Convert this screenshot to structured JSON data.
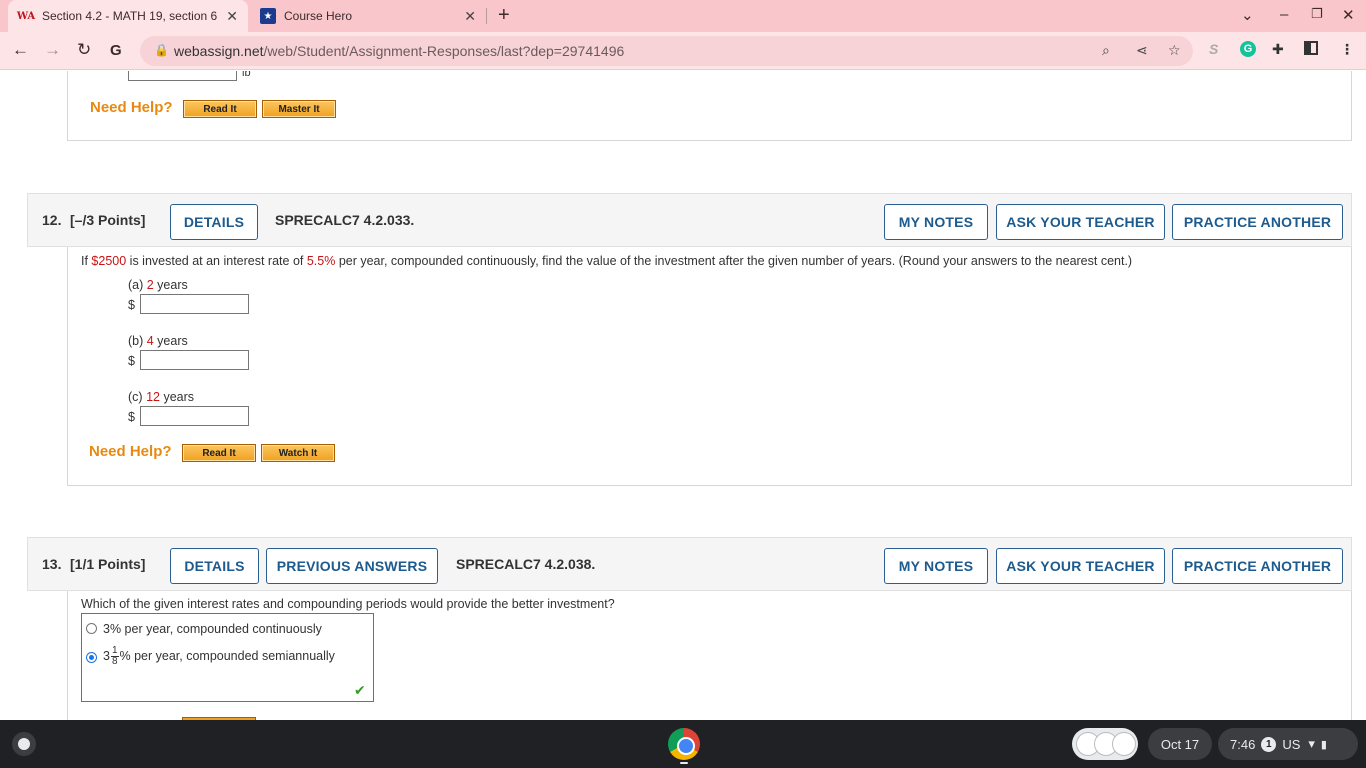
{
  "browser": {
    "tabs": [
      {
        "title": "Section 4.2 - MATH 19, section 6",
        "favicon": "webassign-icon"
      },
      {
        "title": "Course Hero",
        "favicon": "coursehero-icon"
      }
    ],
    "url_host": "webassign.net",
    "url_path": "/web/Student/Assignment-Responses/last?dep=29741496"
  },
  "prev_question": {
    "partial_unit": "lb",
    "need_help": "Need Help?",
    "buttons": [
      "Read It",
      "Master It"
    ]
  },
  "q12": {
    "number": "12.",
    "points": "[–/3 Points]",
    "details": "DETAILS",
    "code": "SPRECALC7 4.2.033.",
    "my_notes": "MY NOTES",
    "ask_teacher": "ASK YOUR TEACHER",
    "practice": "PRACTICE ANOTHER",
    "text_1": "If ",
    "amount": "$2500",
    "text_2": " is invested at an interest rate of ",
    "rate": "5.5%",
    "text_3": " per year, compounded continuously, find the value of the investment after the given number of years. (Round your answers to the nearest cent.)",
    "parts": [
      {
        "label": "(a) ",
        "years": "2",
        "unit": " years",
        "prefix": "$",
        "value": ""
      },
      {
        "label": "(b) ",
        "years": "4",
        "unit": " years",
        "prefix": "$",
        "value": ""
      },
      {
        "label": "(c) ",
        "years": "12",
        "unit": " years",
        "prefix": "$",
        "value": ""
      }
    ],
    "need_help": "Need Help?",
    "buttons": [
      "Read It",
      "Watch It"
    ]
  },
  "q13": {
    "number": "13.",
    "points": "[1/1 Points]",
    "details": "DETAILS",
    "previous": "PREVIOUS ANSWERS",
    "code": "SPRECALC7 4.2.038.",
    "my_notes": "MY NOTES",
    "ask_teacher": "ASK YOUR TEACHER",
    "practice": "PRACTICE ANOTHER",
    "question": "Which of the given interest rates and compounding periods would provide the better investment?",
    "option_1": "3% per year, compounded continuously",
    "option_2_whole": "3",
    "option_2_num": "1",
    "option_2_den": "8",
    "option_2_rest": "% per year, compounded semiannually",
    "selected": 2
  },
  "shelf": {
    "date": "Oct 17",
    "time": "7:46",
    "notifications": "1",
    "locale": "US"
  },
  "colors": {
    "accent": "#1d5a8e",
    "highlight_red": "#c81414",
    "need_help_orange": "#e88a11",
    "correct_green": "#3a9a28",
    "tab_pink": "#f9c6cc"
  }
}
